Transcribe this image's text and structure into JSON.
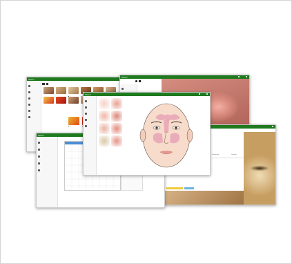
{
  "windows": {
    "thumbnails": {
      "title": "Oticon",
      "thumb_labels": [
        "■ 1",
        "■ 2",
        "■ 3",
        "■ 4",
        "■ 5"
      ]
    },
    "endoscope": {
      "title": "Oticon"
    },
    "anatomy": {
      "title": "Oticon"
    },
    "chart": {
      "title": "Oticon"
    },
    "report": {
      "title": "Oticon",
      "col1": "Description",
      "col2": "Location",
      "col3": "Size"
    }
  },
  "colors": {
    "titlebar": "#1f7a1f",
    "tissue": "#c77b6e",
    "sinus": "#e9a6b8",
    "skin": "#f7dccc"
  }
}
